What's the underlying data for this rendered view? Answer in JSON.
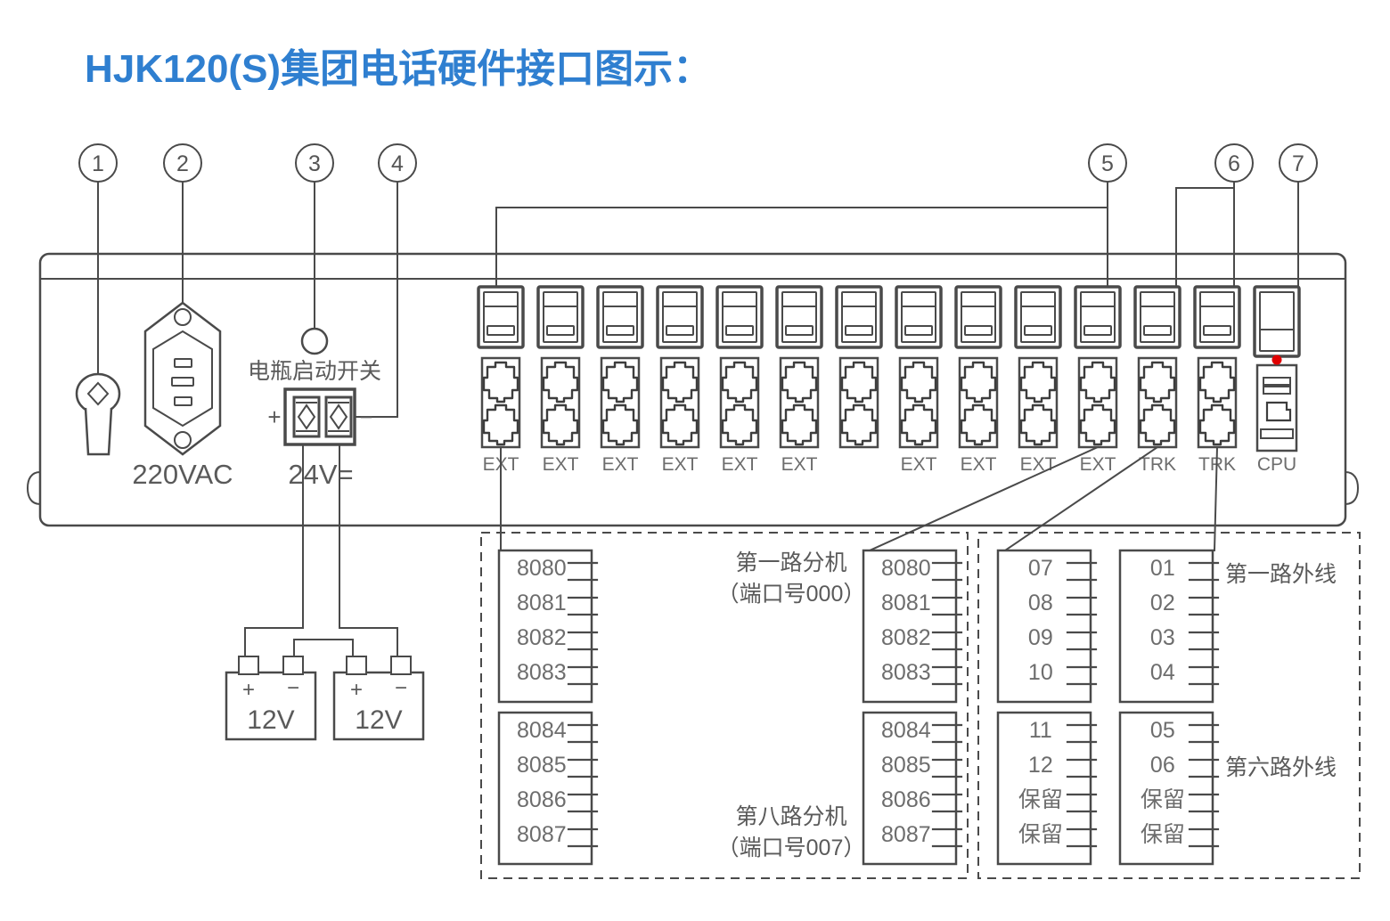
{
  "title": "HJK120(S)集团电话硬件接口图示：",
  "title_color": "#2f7fd0",
  "callouts": [
    {
      "id": "1",
      "label": "1"
    },
    {
      "id": "2",
      "label": "2"
    },
    {
      "id": "3",
      "label": "3"
    },
    {
      "id": "4",
      "label": "4"
    },
    {
      "id": "5",
      "label": "5"
    },
    {
      "id": "6",
      "label": "6"
    },
    {
      "id": "7",
      "label": "7"
    }
  ],
  "chassis": {
    "power_inlet_label": "220VAC",
    "battery_switch_label": "电瓶启动开关",
    "dc_terminal_label": "24V=",
    "plus_sign": "+",
    "minus_sign": "−",
    "led_color": "#e00000"
  },
  "batteries": [
    {
      "voltage": "12V",
      "plus": "+",
      "minus": "−"
    },
    {
      "voltage": "12V",
      "plus": "+",
      "minus": "−"
    }
  ],
  "port_modules": [
    {
      "index": 0,
      "label": "EXT",
      "type": "ext"
    },
    {
      "index": 1,
      "label": "EXT",
      "type": "ext"
    },
    {
      "index": 2,
      "label": "EXT",
      "type": "ext"
    },
    {
      "index": 3,
      "label": "EXT",
      "type": "ext"
    },
    {
      "index": 4,
      "label": "EXT",
      "type": "ext"
    },
    {
      "index": 5,
      "label": "EXT",
      "type": "ext"
    },
    {
      "index": 6,
      "label": "",
      "type": "ext"
    },
    {
      "index": 7,
      "label": "EXT",
      "type": "ext"
    },
    {
      "index": 8,
      "label": "EXT",
      "type": "ext"
    },
    {
      "index": 9,
      "label": "EXT",
      "type": "ext"
    },
    {
      "index": 10,
      "label": "EXT",
      "type": "ext"
    },
    {
      "index": 11,
      "label": "TRK",
      "type": "trk"
    },
    {
      "index": 12,
      "label": "TRK",
      "type": "trk"
    },
    {
      "index": 13,
      "label": "CPU",
      "type": "cpu"
    }
  ],
  "annotations": {
    "first_ext": "第一路分机",
    "first_ext_port": "（端口号000）",
    "eighth_ext": "第八路分机",
    "eighth_ext_port": "（端口号007）",
    "first_trunk": "第一路外线",
    "sixth_trunk": "第六路外线"
  },
  "terminal_blocks": [
    {
      "name": "ext-block-left",
      "upper": [
        "8080",
        "8081",
        "8082",
        "8083"
      ],
      "lower": [
        "8084",
        "8085",
        "8086",
        "8087"
      ]
    },
    {
      "name": "ext-block-right",
      "upper": [
        "8080",
        "8081",
        "8082",
        "8083"
      ],
      "lower": [
        "8084",
        "8085",
        "8086",
        "8087"
      ]
    },
    {
      "name": "trk-block-left",
      "upper": [
        "07",
        "08",
        "09",
        "10"
      ],
      "lower": [
        "11",
        "12",
        "保留",
        "保留"
      ]
    },
    {
      "name": "trk-block-right",
      "upper": [
        "01",
        "02",
        "03",
        "04"
      ],
      "lower": [
        "05",
        "06",
        "保留",
        "保留"
      ]
    }
  ]
}
